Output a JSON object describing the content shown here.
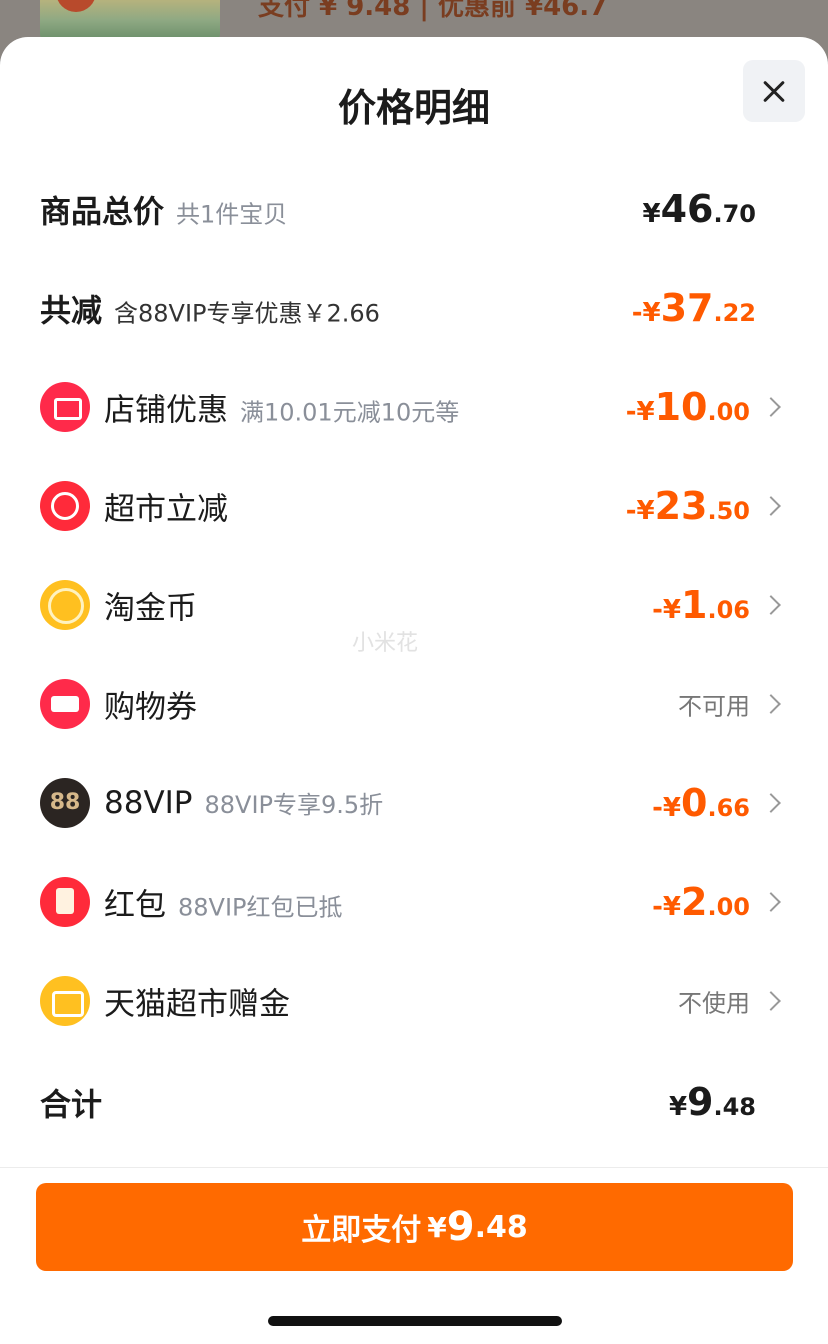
{
  "title": "价格明细",
  "watermark": "小米花",
  "summary": {
    "goods_total": {
      "label": "商品总价",
      "sub": "共1件宝贝",
      "sym": "¥",
      "int": "46",
      "dec": ".70"
    },
    "discount": {
      "label": "共减",
      "sub": "含88VIP专享优惠￥2.66",
      "sym": "-¥",
      "int": "37",
      "dec": ".22"
    }
  },
  "items": [
    {
      "label": "店铺优惠",
      "sub": "满10.01元减10元等",
      "sym": "-¥",
      "int": "10",
      "dec": ".00"
    },
    {
      "label": "超市立减",
      "sub": "",
      "sym": "-¥",
      "int": "23",
      "dec": ".50"
    },
    {
      "label": "淘金币",
      "sub": "",
      "sym": "-¥",
      "int": "1",
      "dec": ".06"
    },
    {
      "label": "购物券",
      "sub": "",
      "text": "不可用"
    },
    {
      "label": "88VIP",
      "sub": "88VIP专享9.5折",
      "sym": "-¥",
      "int": "0",
      "dec": ".66",
      "icon_text": "88"
    },
    {
      "label": "红包",
      "sub": "88VIP红包已抵",
      "sym": "-¥",
      "int": "2",
      "dec": ".00"
    },
    {
      "label": "天猫超市赠金",
      "sub": "",
      "text": "不使用"
    }
  ],
  "total": {
    "label": "合计",
    "sym": "¥",
    "int": "9",
    "dec": ".48"
  },
  "pay_button": {
    "label": "立即支付",
    "sym": "¥",
    "int": "9",
    "dec": ".48"
  },
  "colors": {
    "accent": "#ff6a00",
    "discount": "#ff5a00"
  },
  "icons": [
    "shop-icon",
    "supermarket-discount-icon",
    "taojinbi-coin-icon",
    "coupon-icon",
    "88vip-icon",
    "red-packet-icon",
    "gift-gold-icon"
  ]
}
